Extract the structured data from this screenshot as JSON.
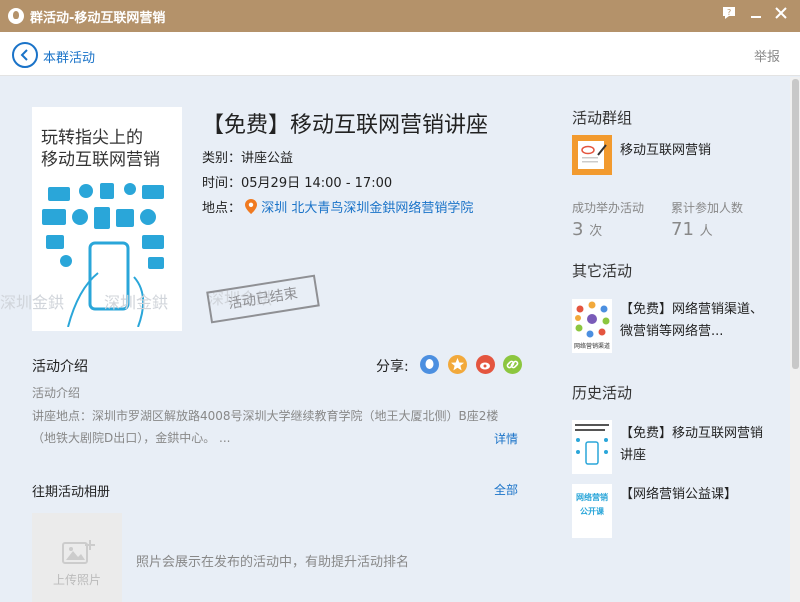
{
  "window": {
    "title": "群活动-移动互联网营销"
  },
  "nav": {
    "back_label": "本群活动",
    "report": "举报"
  },
  "activity": {
    "poster_line1": "玩转指尖上的",
    "poster_line2": "移动互联网营销",
    "title": "【免费】移动互联网营销讲座",
    "category_label": "类别：",
    "category": "讲座公益",
    "time_label": "时间：",
    "time": "05月29日 14:00 - 17:00",
    "location_label": "地点：",
    "location": "深圳 北大青鸟深圳金鉷网络营销学院",
    "stamp": "活动已结束",
    "watermark1": "深圳金鉷",
    "watermark2": "深圳金鉷",
    "watermark3": "深圳金鉷"
  },
  "intro": {
    "section_title": "活动介绍",
    "share_label": "分享:",
    "sub_label": "活动介绍",
    "text": "讲座地点：深圳市罗湖区解放路4008号深圳大学继续教育学院（地王大厦北侧）B座2楼（地铁大剧院D出口），金鉷中心。 ...",
    "more_link": "详情"
  },
  "album": {
    "section_title": "往期活动相册",
    "all_link": "全部",
    "upload_label": "上传照片",
    "hint": "照片会展示在发布的活动中，有助提升活动排名"
  },
  "group": {
    "section_title": "活动群组",
    "name": "移动互联网营销",
    "stat1_label": "成功举办活动",
    "stat1_value": "3",
    "stat1_unit": "次",
    "stat2_label": "累计参加人数",
    "stat2_value": "71",
    "stat2_unit": "人"
  },
  "other": {
    "section_title": "其它活动",
    "item1": "【免费】网络营销渠道、微营销等网络营...",
    "item1_thumb": "网络营销渠道"
  },
  "history": {
    "section_title": "历史活动",
    "item1": "【免费】移动互联网营销讲座",
    "item2": "【网络营销公益课】",
    "item2_thumb1": "网络营销",
    "item2_thumb2": "公开课"
  },
  "colors": {
    "titlebar": "#b4926a",
    "link": "#1a73c8",
    "accent_orange": "#f29a2e"
  }
}
